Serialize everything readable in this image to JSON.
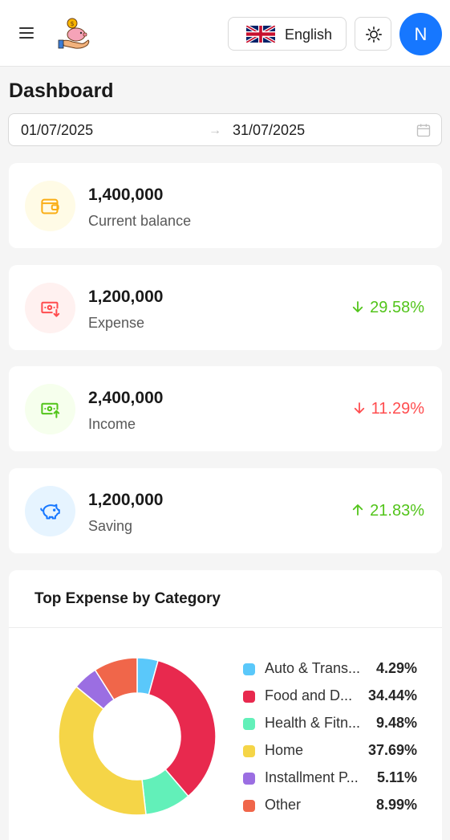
{
  "header": {
    "language": "English",
    "avatar_initial": "N"
  },
  "page": {
    "title": "Dashboard"
  },
  "date_range": {
    "start": "01/07/2025",
    "end": "31/07/2025",
    "separator": "→"
  },
  "stats": [
    {
      "amount": "1,400,000",
      "label": "Current balance",
      "icon": "wallet-icon",
      "color": "#faad14"
    },
    {
      "amount": "1,200,000",
      "label": "Expense",
      "icon": "money-down-icon",
      "color": "#ff4d4f",
      "change": "29.58%",
      "direction": "down",
      "change_color": "#52c41a"
    },
    {
      "amount": "2,400,000",
      "label": "Income",
      "icon": "money-up-icon",
      "color": "#52c41a",
      "change": "11.29%",
      "direction": "down",
      "change_color": "#ff4d4f"
    },
    {
      "amount": "1,200,000",
      "label": "Saving",
      "icon": "piggy-bank-icon",
      "color": "#1677ff",
      "change": "21.83%",
      "direction": "up",
      "change_color": "#52c41a"
    }
  ],
  "chart_data": {
    "type": "pie",
    "title": "Top Expense by Category",
    "categories": [
      "Auto & Trans...",
      "Food and D...",
      "Health & Fitn...",
      "Home",
      "Installment P...",
      "Other"
    ],
    "values": [
      4.29,
      34.44,
      9.48,
      37.69,
      5.11,
      8.99
    ],
    "labels": [
      "4.29%",
      "34.44%",
      "9.48%",
      "37.69%",
      "5.11%",
      "8.99%"
    ],
    "colors": [
      "#5ac8fa",
      "#e8294e",
      "#62f0b9",
      "#f5d547",
      "#9b6ee2",
      "#f0664a"
    ],
    "legend": "right"
  }
}
